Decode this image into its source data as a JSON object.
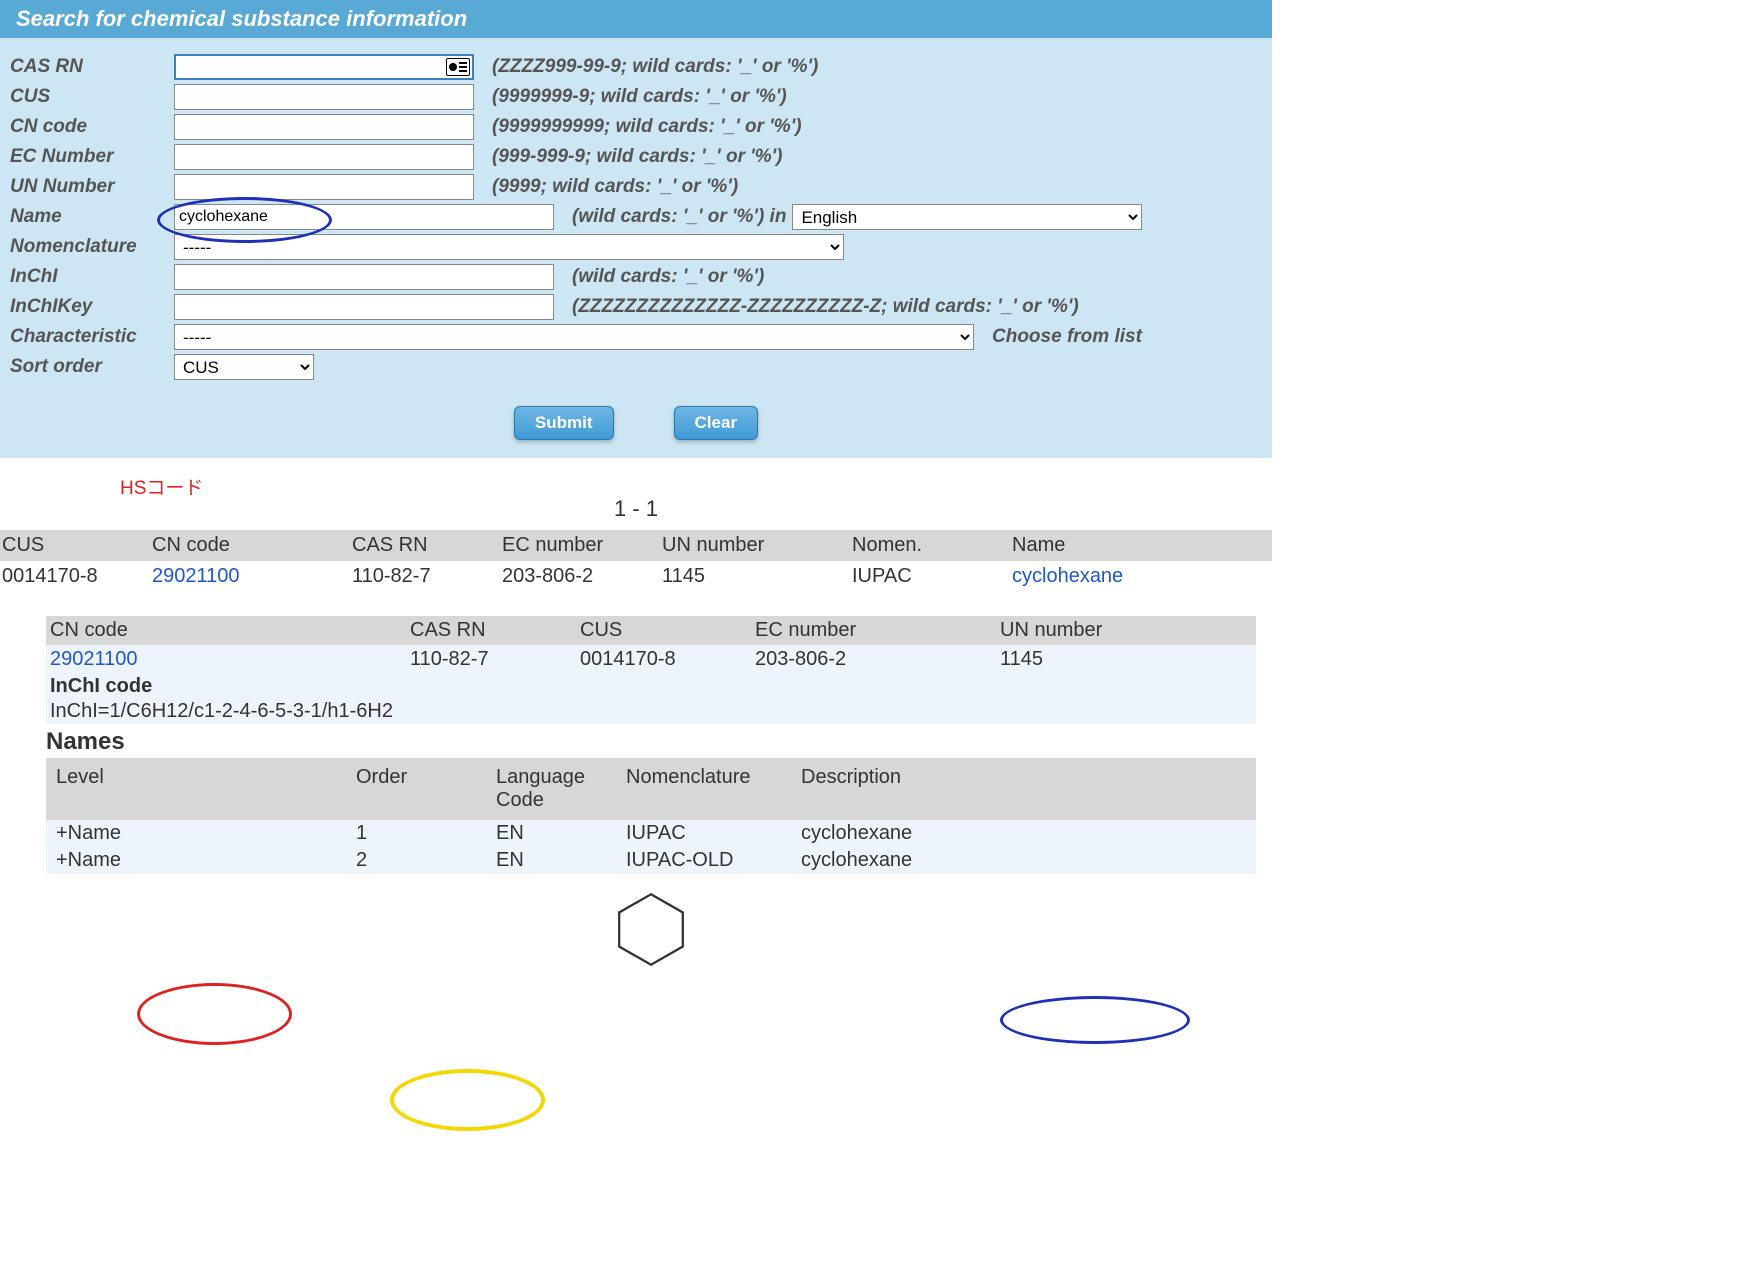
{
  "header": {
    "title": "Search for chemical substance information"
  },
  "form": {
    "cas_rn": {
      "label": "CAS RN",
      "value": "",
      "hint": "(ZZZZ999-99-9; wild cards: '_' or '%')"
    },
    "cus": {
      "label": "CUS",
      "value": "",
      "hint": "(9999999-9; wild cards: '_' or '%')"
    },
    "cn": {
      "label": "CN code",
      "value": "",
      "hint": "(9999999999; wild cards: '_' or '%')"
    },
    "ec": {
      "label": "EC Number",
      "value": "",
      "hint": "(999-999-9; wild cards: '_' or '%')"
    },
    "un": {
      "label": "UN Number",
      "value": "",
      "hint": "(9999; wild cards: '_' or '%')"
    },
    "name": {
      "label": "Name",
      "value": "cyclohexane",
      "hint": "(wild cards: '_' or '%') in",
      "lang": "English"
    },
    "nomenclature": {
      "label": "Nomenclature",
      "value": "-----"
    },
    "inchi": {
      "label": "InChI",
      "value": "",
      "hint": "(wild cards: '_' or '%')"
    },
    "inchikey": {
      "label": "InChIKey",
      "value": "",
      "hint": "(ZZZZZZZZZZZZZZ-ZZZZZZZZZZ-Z; wild cards: '_' or '%')"
    },
    "characteristic": {
      "label": "Characteristic",
      "value": "-----",
      "hint": "Choose from list"
    },
    "sort": {
      "label": "Sort order",
      "value": "CUS"
    },
    "buttons": {
      "submit": "Submit",
      "clear": "Clear"
    }
  },
  "annotations": {
    "hs_code_label": "HSコード"
  },
  "results": {
    "count": "1 - 1",
    "columns": [
      "CUS",
      "CN code",
      "CAS RN",
      "EC number",
      "UN number",
      "Nomen.",
      "Name"
    ],
    "row": {
      "cus": "0014170-8",
      "cn": "29021100",
      "cas": "110-82-7",
      "ec": "203-806-2",
      "un": "1145",
      "nomen": "IUPAC",
      "name": "cyclohexane"
    }
  },
  "detail": {
    "columns": [
      "CN code",
      "CAS RN",
      "CUS",
      "EC number",
      "UN number"
    ],
    "row": {
      "cn": "29021100",
      "cas": "110-82-7",
      "cus": "0014170-8",
      "ec": "203-806-2",
      "un": "1145"
    },
    "inchi": {
      "label": "InChI code",
      "value": "InChI=1/C6H12/c1-2-4-6-5-3-1/h1-6H2"
    },
    "names_title": "Names",
    "names_columns": {
      "level": "Level",
      "order": "Order",
      "lang": "Language Code",
      "nomen": "Nomenclature",
      "desc": "Description"
    },
    "names": [
      {
        "level": "+Name",
        "order": "1",
        "lang": "EN",
        "nomen": "IUPAC",
        "desc": "cyclohexane"
      },
      {
        "level": "+Name",
        "order": "2",
        "lang": "EN",
        "nomen": "IUPAC-OLD",
        "desc": "cyclohexane"
      }
    ]
  }
}
